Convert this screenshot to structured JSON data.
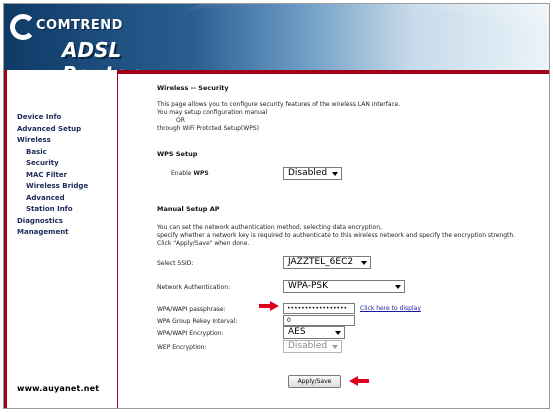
{
  "header": {
    "brand": "COMTREND",
    "product": "ADSL Router"
  },
  "sidebar": {
    "items": [
      {
        "label": "Device Info",
        "sub": false
      },
      {
        "label": "Advanced Setup",
        "sub": false
      },
      {
        "label": "Wireless",
        "sub": false
      },
      {
        "label": "Basic",
        "sub": true
      },
      {
        "label": "Security",
        "sub": true
      },
      {
        "label": "MAC Filter",
        "sub": true
      },
      {
        "label": "Wireless Bridge",
        "sub": true
      },
      {
        "label": "Advanced",
        "sub": true
      },
      {
        "label": "Station Info",
        "sub": true
      },
      {
        "label": "Diagnostics",
        "sub": false
      },
      {
        "label": "Management",
        "sub": false
      }
    ],
    "site_url": "www.auyanet.net"
  },
  "content": {
    "title": "Wireless -- Security",
    "intro1": "This page allows you to configure security features of the wireless LAN interface.",
    "intro2": "You may setup configuration manual",
    "intro_or": "OR",
    "intro3": "through WiFi Protcted Setup(WPS)",
    "wps_heading": "WPS Setup",
    "enable_wps_prefix": "Enable ",
    "enable_wps_bold": "WPS",
    "wps_value": "Disabled",
    "manual_heading": "Manual Setup AP",
    "manual1": "You can set the network authentication method, selecting data encryption,",
    "manual2": "specify whether a network key is required to authenticate to this wireless network and specify the encryption strength.",
    "manual3": "Click \"Apply/Save\" when done.",
    "ssid_label": "Select SSID:",
    "ssid_value": "JAZZTEL_6EC2",
    "auth_label": "Network Authentication:",
    "auth_value": "WPA-PSK",
    "passphrase_label": "WPA/WAPI passphrase:",
    "passphrase_value": "•••••••••••••••••",
    "display_link": "Click here to display",
    "rekey_label": "WPA Group Rekey Interval:",
    "rekey_value": "0",
    "encryption_label": "WPA/WAPI Encryption:",
    "encryption_value": "AES",
    "wep_label": "WEP Encryption:",
    "wep_value": "Disabled",
    "apply_label": "Apply/Save"
  },
  "colors": {
    "accent_red": "#a3001a",
    "arrow_red": "#e0001b",
    "nav_text": "#1c2a56",
    "link": "#1a1aa8"
  }
}
